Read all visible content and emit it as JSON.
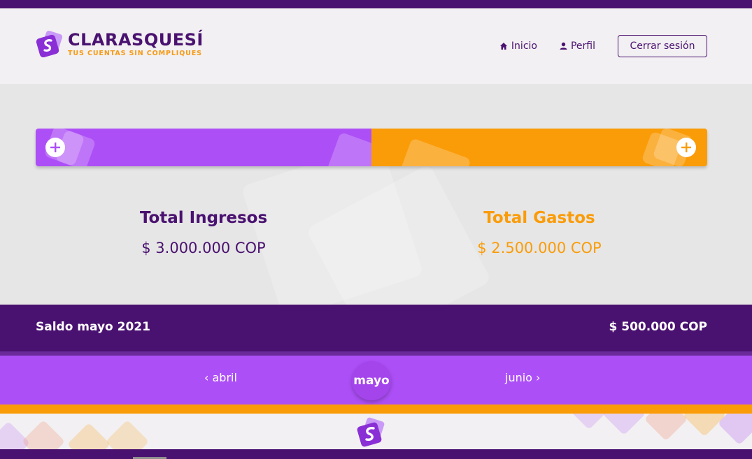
{
  "brand": {
    "name": "CLARASQUESÍ",
    "tagline": "TUS CUENTAS SIN COMPLIQUES",
    "logo_icon": "claras-logo-icon"
  },
  "nav": {
    "home_label": "Inicio",
    "home_icon": "home-icon",
    "profile_label": "Perfil",
    "profile_icon": "user-icon",
    "logout_label": "Cerrar sesión"
  },
  "actions": {
    "add_income_icon": "plus-icon",
    "add_expense_icon": "plus-icon"
  },
  "summary": {
    "income_title": "Total Ingresos",
    "income_value": "$ 3.000.000 COP",
    "expense_title": "Total Gastos",
    "expense_value": "$ 2.500.000 COP"
  },
  "balance": {
    "label": "Saldo mayo 2021",
    "value": "$ 500.000 COP"
  },
  "months": {
    "prev": "‹ abril",
    "current": "mayo",
    "next": "junio ›"
  },
  "colors": {
    "primary_dark": "#4a1270",
    "purple": "#ad4ff7",
    "orange": "#fa9c08",
    "light_bg": "#f2f0f2",
    "main_bg": "#e6e6e6"
  }
}
